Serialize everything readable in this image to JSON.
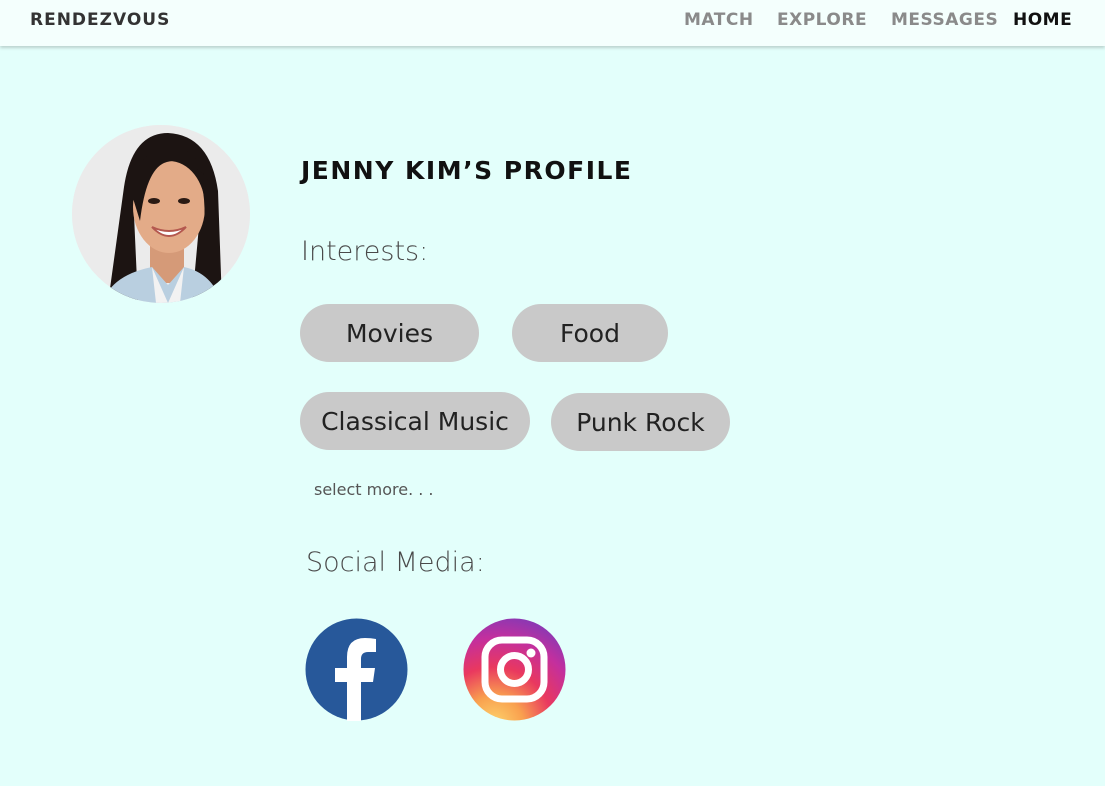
{
  "brand": "RENDEZVOUS",
  "nav": {
    "items": [
      {
        "label": "MATCH",
        "active": false
      },
      {
        "label": "EXPLORE",
        "active": false
      },
      {
        "label": "MESSAGES",
        "active": false
      },
      {
        "label": "HOME",
        "active": true
      }
    ]
  },
  "profile": {
    "title": "JENNY KIM’S PROFILE",
    "interests_label": "Interests:",
    "interests": [
      "Movies",
      "Food",
      "Classical Music",
      "Punk Rock"
    ],
    "select_more": "select more. . .",
    "social_label": "Social Media:"
  },
  "colors": {
    "background": "#e3fffb",
    "pill": "#c9c9c9",
    "facebook": "#27589a"
  },
  "icons": {
    "facebook": "facebook-icon",
    "instagram": "instagram-icon"
  }
}
